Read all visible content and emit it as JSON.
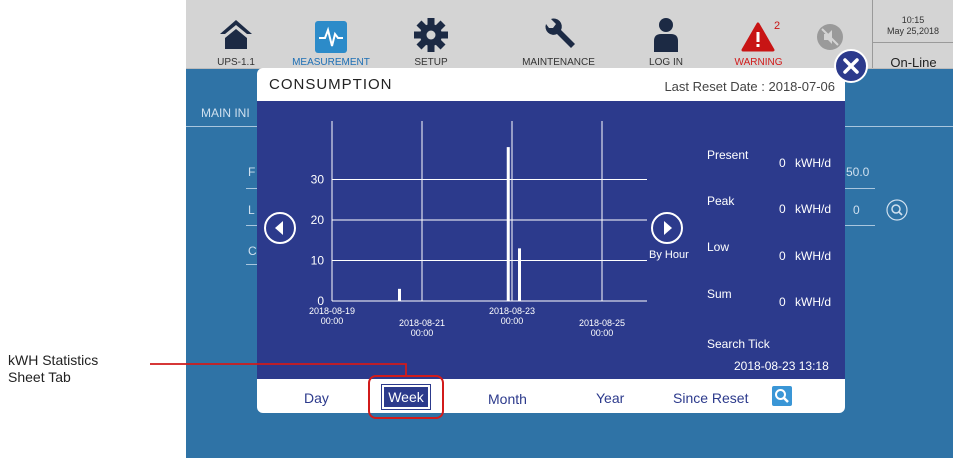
{
  "topbar": {
    "items": [
      {
        "label": "UPS-1.1",
        "icon": "home-icon"
      },
      {
        "label": "MEASUREMENT",
        "icon": "waveform-icon"
      },
      {
        "label": "SETUP",
        "icon": "gear-icon"
      },
      {
        "label": "MAINTENANCE",
        "icon": "wrench-icon"
      },
      {
        "label": "LOG IN",
        "icon": "user-icon"
      },
      {
        "label": "WARNING",
        "icon": "warning-icon",
        "badge": "2"
      }
    ],
    "mute_icon": "speaker-mute-icon",
    "clock_time": "10:15",
    "clock_date": "May 25,2018",
    "status": "On-Line"
  },
  "background": {
    "section_label": "MAIN INI",
    "row1_letter": "F",
    "row2_letter": "L",
    "row3_letter": "C",
    "value_right": "50.0",
    "value_zero": "0"
  },
  "dialog": {
    "title": "CONSUMPTION",
    "last_reset": "Last Reset Date : 2018-07-06",
    "by_hour_label": "By Hour",
    "stats": {
      "present_label": "Present",
      "present_value": "0",
      "present_unit": "kWH/d",
      "peak_label": "Peak",
      "peak_value": "0",
      "peak_unit": "kWH/d",
      "low_label": "Low",
      "low_value": "0",
      "low_unit": "kWH/d",
      "sum_label": "Sum",
      "sum_value": "0",
      "sum_unit": "kWH/d"
    },
    "search_tick_label": "Search Tick",
    "search_tick_value": "2018-08-23 13:18",
    "tabs": {
      "day": "Day",
      "week": "Week",
      "month": "Month",
      "year": "Year",
      "since_reset": "Since Reset"
    }
  },
  "callout": {
    "line1": "kWH Statistics",
    "line2": "Sheet Tab",
    "color": "#d11b1b"
  },
  "colors": {
    "panel": "#2c3a8c",
    "screen": "#2f73a6",
    "topbar": "#d4d4d4",
    "warning": "#d11b1b"
  },
  "chart_data": {
    "type": "bar",
    "yticks": [
      "0",
      "10",
      "20",
      "30"
    ],
    "ylim": [
      0,
      40
    ],
    "xticks": [
      {
        "date": "2018-08-19",
        "time": "00:00"
      },
      {
        "date": "2018-08-21",
        "time": "00:00"
      },
      {
        "date": "2018-08-23",
        "time": "00:00"
      },
      {
        "date": "2018-08-25",
        "time": "00:00"
      }
    ],
    "x_start": "2018-08-19 00:00",
    "x_end": "2018-08-26 00:00",
    "bars": [
      {
        "x": "2018-08-20 12:00",
        "value": 3
      },
      {
        "x": "2018-08-22 22:00",
        "value": 38
      },
      {
        "x": "2018-08-23 04:00",
        "value": 13
      }
    ]
  }
}
